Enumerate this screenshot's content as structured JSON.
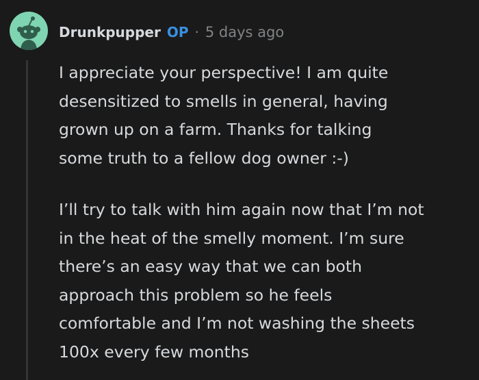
{
  "comment": {
    "avatar_icon": "snoo-avatar-icon",
    "username": "Drunkpupper",
    "op_badge": "OP",
    "separator": "·",
    "timestamp": "5 days ago",
    "paragraphs": [
      {
        "lines": [
          "I appreciate your perspective! I am quite",
          "desensitized to smells in general, having",
          "grown up on a farm. Thanks for talking",
          "some truth to a fellow dog owner :-)"
        ]
      },
      {
        "lines": [
          "I’ll try to talk with him again now that I’m not",
          "in the heat of the smelly moment. I’m sure",
          "there’s an easy way that we can both",
          "approach this problem so he feels",
          "comfortable and I’m not washing the sheets",
          "100x every few months"
        ]
      }
    ]
  },
  "colors": {
    "background": "#1a1a1b",
    "text": "#d7dadc",
    "meta": "#818384",
    "op_badge": "#3a8fe0",
    "avatar_bg": "#7fd4b1",
    "thread_line": "#343536"
  }
}
